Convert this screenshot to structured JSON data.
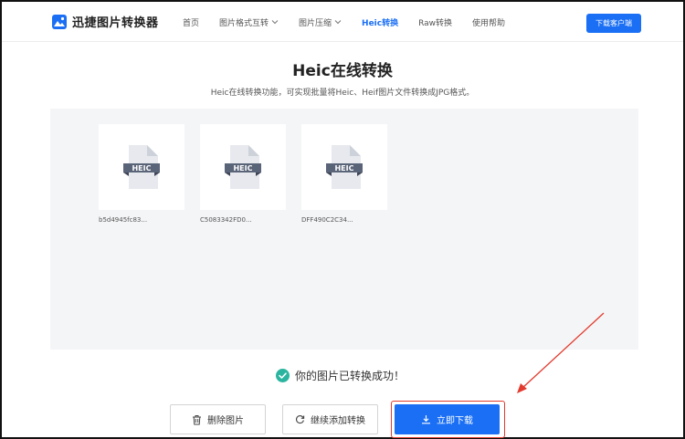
{
  "app": {
    "name": "迅捷图片转换器"
  },
  "nav": [
    {
      "label": "首页",
      "dropdown": false,
      "active": false
    },
    {
      "label": "图片格式互转",
      "dropdown": true,
      "active": false
    },
    {
      "label": "图片压缩",
      "dropdown": true,
      "active": false
    },
    {
      "label": "Heic转换",
      "dropdown": false,
      "active": true
    },
    {
      "label": "Raw转换",
      "dropdown": false,
      "active": false
    },
    {
      "label": "使用帮助",
      "dropdown": false,
      "active": false
    }
  ],
  "header": {
    "download_client_label": "下载客户端"
  },
  "page": {
    "title": "Heic在线转换",
    "subtitle": "Heic在线转换功能，可实现批量将Heic、Heif图片文件转换成JPG格式。"
  },
  "files": [
    {
      "badge": "HEIC",
      "name": "b5d4945fc83..."
    },
    {
      "badge": "HEIC",
      "name": "C5083342FD0..."
    },
    {
      "badge": "HEIC",
      "name": "DFF490C2C34..."
    }
  ],
  "status": {
    "message": "你的图片已转换成功！"
  },
  "actions": {
    "delete_label": "删除图片",
    "continue_label": "继续添加转换",
    "download_label": "立即下载"
  },
  "colors": {
    "accent": "#1a6ff5",
    "success": "#2bb5a0",
    "annotation": "#e23b2e",
    "file_badge": "#5a6478"
  }
}
